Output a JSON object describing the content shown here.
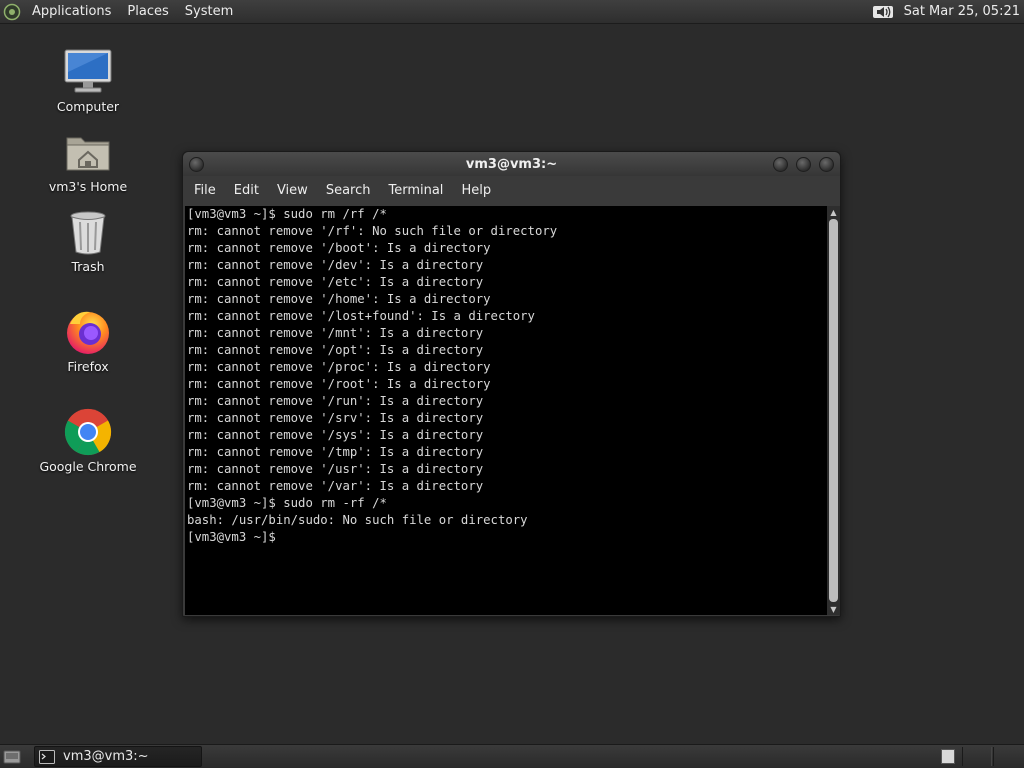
{
  "top_panel": {
    "menus": [
      "Applications",
      "Places",
      "System"
    ],
    "clock": "Sat Mar 25, 05:21"
  },
  "desktop_icons": [
    {
      "label": "Computer",
      "icon": "computer-icon"
    },
    {
      "label": "vm3's Home",
      "icon": "home-folder-icon"
    },
    {
      "label": "Trash",
      "icon": "trash-icon"
    },
    {
      "label": "Firefox",
      "icon": "firefox-icon"
    },
    {
      "label": "Google Chrome",
      "icon": "chrome-icon"
    }
  ],
  "terminal": {
    "title": "vm3@vm3:~",
    "menus": [
      "File",
      "Edit",
      "View",
      "Search",
      "Terminal",
      "Help"
    ],
    "lines": [
      "[vm3@vm3 ~]$ sudo rm /rf /*",
      "rm: cannot remove '/rf': No such file or directory",
      "rm: cannot remove '/boot': Is a directory",
      "rm: cannot remove '/dev': Is a directory",
      "rm: cannot remove '/etc': Is a directory",
      "rm: cannot remove '/home': Is a directory",
      "rm: cannot remove '/lost+found': Is a directory",
      "rm: cannot remove '/mnt': Is a directory",
      "rm: cannot remove '/opt': Is a directory",
      "rm: cannot remove '/proc': Is a directory",
      "rm: cannot remove '/root': Is a directory",
      "rm: cannot remove '/run': Is a directory",
      "rm: cannot remove '/srv': Is a directory",
      "rm: cannot remove '/sys': Is a directory",
      "rm: cannot remove '/tmp': Is a directory",
      "rm: cannot remove '/usr': Is a directory",
      "rm: cannot remove '/var': Is a directory",
      "[vm3@vm3 ~]$ sudo rm -rf /*",
      "bash: /usr/bin/sudo: No such file or directory",
      "[vm3@vm3 ~]$"
    ]
  },
  "taskbar": {
    "window_button": "vm3@vm3:~"
  },
  "colors": {
    "desktop_bg": "#2b2b2b",
    "terminal_bg": "#000000",
    "terminal_fg": "#d8d8d8"
  }
}
